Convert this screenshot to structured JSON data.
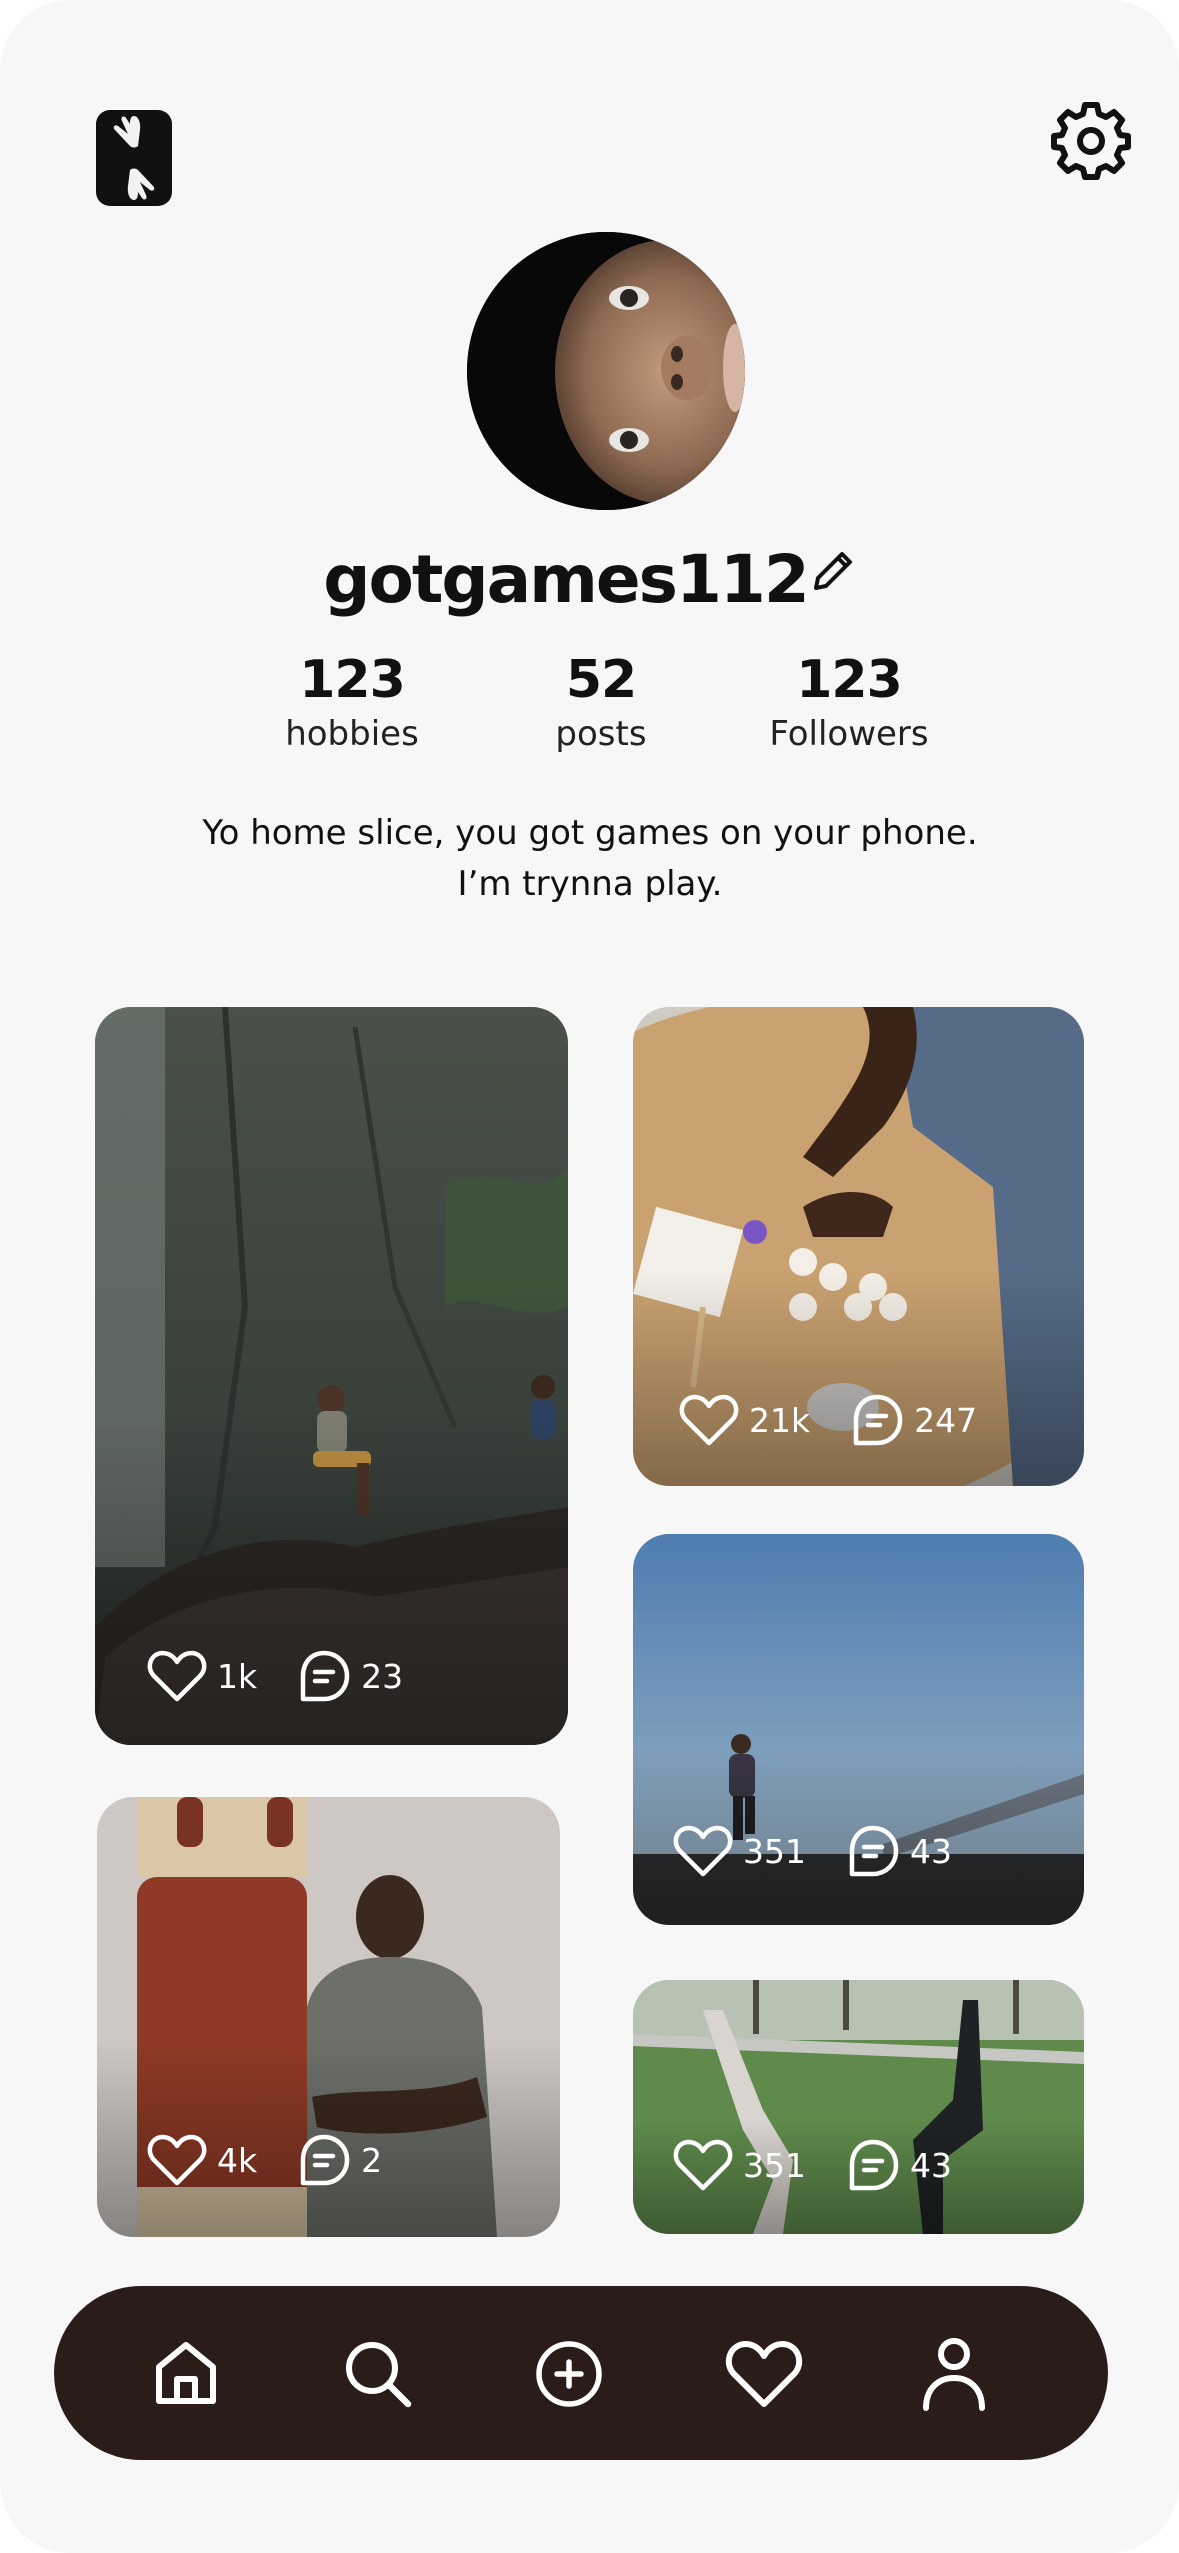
{
  "profile": {
    "username": "gotgames112",
    "bio": "Yo home slice, you got games on your phone. I’m trynna play.",
    "stats": [
      {
        "value": "123",
        "label": "hobbies"
      },
      {
        "value": "52",
        "label": "posts"
      },
      {
        "value": "123",
        "label": "Followers"
      }
    ]
  },
  "icons": {
    "logo": "app-logo-hands",
    "settings": "gear-icon",
    "edit": "pencil-icon",
    "like": "heart-icon",
    "comment": "comment-bubble-icon"
  },
  "posts": [
    {
      "likes": "1k",
      "comments": "23"
    },
    {
      "likes": "21k",
      "comments": "247"
    },
    {
      "likes": "351",
      "comments": "43"
    },
    {
      "likes": "4k",
      "comments": "2"
    },
    {
      "likes": "351",
      "comments": "43"
    }
  ],
  "nav": {
    "items": [
      "home-icon",
      "search-icon",
      "add-circle-icon",
      "heart-icon",
      "profile-icon"
    ],
    "active": "profile-icon"
  },
  "colors": {
    "background": "#f7f7f7",
    "navbar": "#2a1c19",
    "text": "#111111"
  }
}
